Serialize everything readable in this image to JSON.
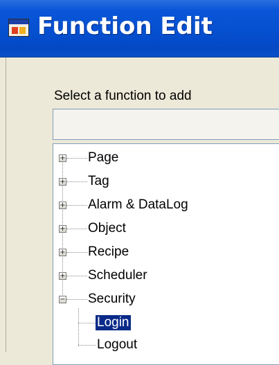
{
  "window": {
    "title": "Function Edit",
    "icon": "app-window-icon"
  },
  "form": {
    "select_label": "Select a function to add",
    "search_value": ""
  },
  "tree": {
    "nodes": [
      {
        "label": "Page",
        "expanded": false
      },
      {
        "label": "Tag",
        "expanded": false
      },
      {
        "label": "Alarm & DataLog",
        "expanded": false
      },
      {
        "label": "Object",
        "expanded": false
      },
      {
        "label": "Recipe",
        "expanded": false
      },
      {
        "label": "Scheduler",
        "expanded": false
      },
      {
        "label": "Security",
        "expanded": true,
        "children": [
          {
            "label": "Login",
            "selected": true
          },
          {
            "label": "Logout",
            "selected": false
          }
        ]
      }
    ]
  },
  "colors": {
    "titlebar": "#0550d0",
    "selection": "#0a2a88",
    "dialog_bg": "#ece9d8"
  }
}
